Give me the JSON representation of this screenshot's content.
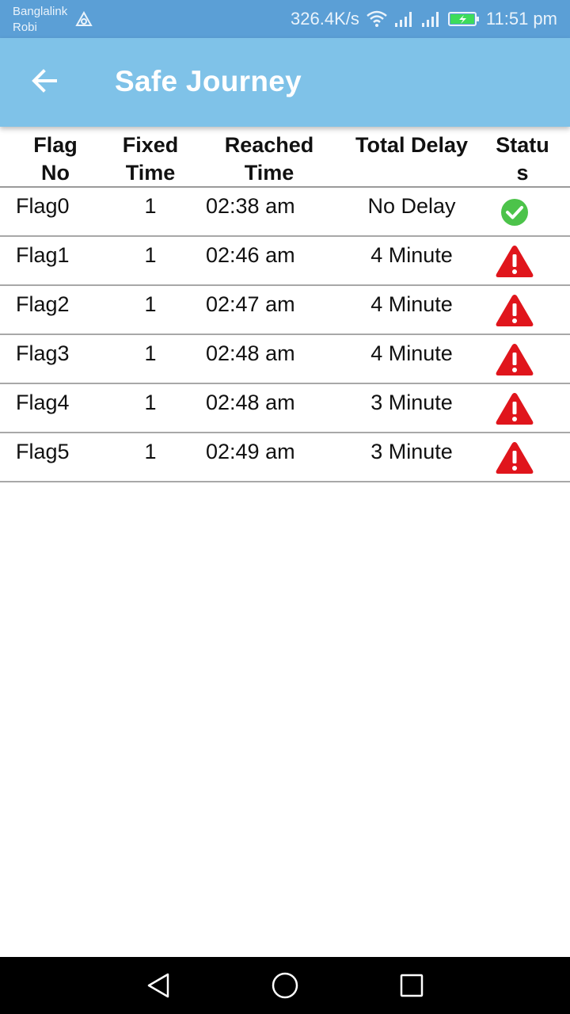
{
  "status_bar": {
    "carrier_1": "Banglalink",
    "carrier_2": "Robi",
    "speed": "326.4K/s",
    "time": "11:51 pm"
  },
  "app_bar": {
    "title": "Safe Journey",
    "back_icon": "arrow-left-icon"
  },
  "table": {
    "headers": [
      "Flag No",
      "Fixed Time",
      "Reached Time",
      "Total Delay",
      "Status"
    ],
    "rows": [
      {
        "flag": "Flag0",
        "fixed": "1",
        "reached": "02:38 am",
        "delay": "No Delay",
        "status": "ok"
      },
      {
        "flag": "Flag1",
        "fixed": "1",
        "reached": "02:46 am",
        "delay": "4 Minute",
        "status": "warning"
      },
      {
        "flag": "Flag2",
        "fixed": "1",
        "reached": "02:47 am",
        "delay": "4 Minute",
        "status": "warning"
      },
      {
        "flag": "Flag3",
        "fixed": "1",
        "reached": "02:48 am",
        "delay": "4 Minute",
        "status": "warning"
      },
      {
        "flag": "Flag4",
        "fixed": "1",
        "reached": "02:48 am",
        "delay": "3 Minute",
        "status": "warning"
      },
      {
        "flag": "Flag5",
        "fixed": "1",
        "reached": "02:49 am",
        "delay": "3 Minute",
        "status": "warning"
      }
    ]
  },
  "colors": {
    "status_bar": "#5b9fd6",
    "app_bar": "#7fc2e8",
    "ok": "#4cc34a",
    "warning": "#e0151c"
  },
  "nav_bar": {
    "back_icon": "nav-back-triangle-icon",
    "home_icon": "nav-home-circle-icon",
    "recents_icon": "nav-recents-square-icon"
  }
}
